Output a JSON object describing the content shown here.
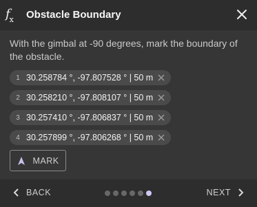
{
  "header": {
    "title": "Obstacle Boundary",
    "icon": "function-icon",
    "close_icon": "close-icon"
  },
  "instruction": "With the gimbal at -90 degrees, mark the boundary of the obstacle.",
  "points": [
    {
      "index": "1",
      "label": "30.258784 °, -97.807528 ° | 50 m"
    },
    {
      "index": "2",
      "label": "30.258210 °, -97.808107 ° | 50 m"
    },
    {
      "index": "3",
      "label": "30.257410 °, -97.806837 ° | 50 m"
    },
    {
      "index": "4",
      "label": "30.257899 °, -97.806268 ° | 50 m"
    }
  ],
  "mark_button": {
    "label": "MARK",
    "icon": "navigation-arrow-icon"
  },
  "footer": {
    "back_label": "BACK",
    "next_label": "NEXT",
    "steps_total": 6,
    "current_step": 6
  },
  "colors": {
    "background": "#363636",
    "header_bg": "#2d2d2d",
    "chip_bg": "#4a4a4a",
    "active_dot": "#cfc6f2"
  }
}
